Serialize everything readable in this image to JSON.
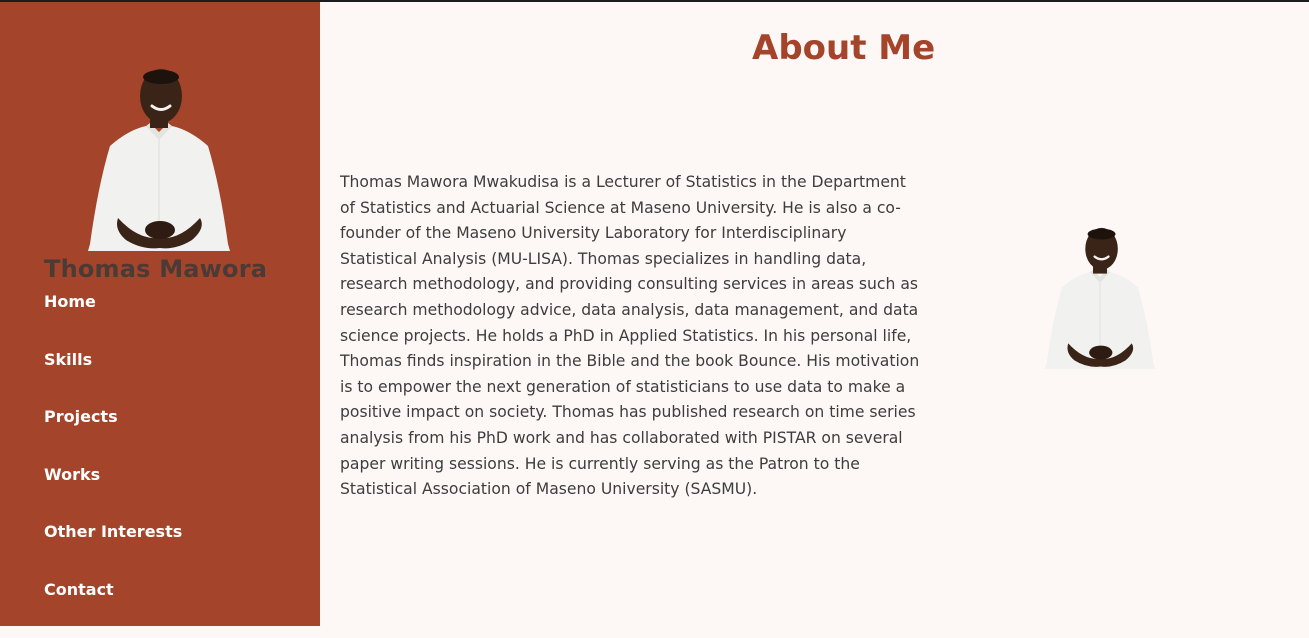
{
  "sidebar": {
    "name": "Thomas Mawora",
    "nav": [
      {
        "label": "Home"
      },
      {
        "label": "Skills"
      },
      {
        "label": "Projects"
      },
      {
        "label": "Works"
      },
      {
        "label": "Other Interests"
      },
      {
        "label": "Contact"
      }
    ]
  },
  "main": {
    "title": "About Me",
    "bio": "Thomas Mawora Mwakudisa is a Lecturer of Statistics in the Department of Statistics and Actuarial Science at Maseno University. He is also a co-founder of the Maseno University Laboratory for Interdisciplinary Statistical Analysis (MU-LISA). Thomas specializes in handling data, research methodology, and providing consulting services in areas such as research methodology advice, data analysis, data management, and data science projects. He holds a PhD in Applied Statistics. In his personal life, Thomas finds inspiration in the Bible and the book Bounce. His motivation is to empower the next generation of statisticians to use data to make a positive impact on society. Thomas has published research on time series analysis from his PhD work and has collaborated with PISTAR on several paper writing sessions. He is currently serving as the Patron to the Statistical Association of Maseno University (SASMU)."
  },
  "colors": {
    "sidebar_bg": "#a4442a",
    "accent": "#a4442a",
    "page_bg": "#fdf8f6",
    "text": "#3d3d3d"
  }
}
